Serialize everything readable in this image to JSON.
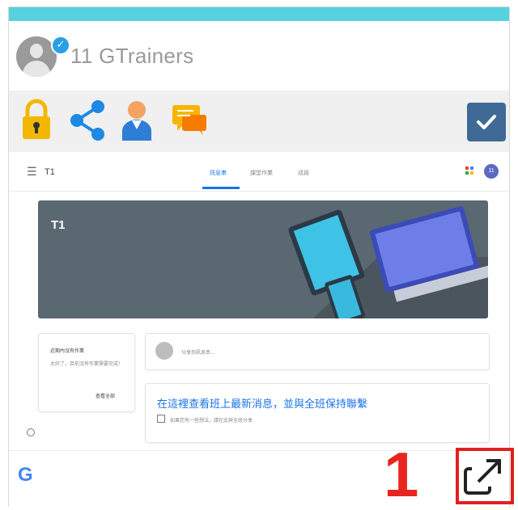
{
  "header": {
    "title": "11 GTrainers"
  },
  "toolbar": {
    "icons": [
      "lock-icon",
      "share-icon",
      "user-icon",
      "chat-icon"
    ],
    "check_icon": "check-icon"
  },
  "classroom": {
    "class_name": "T1",
    "tabs": [
      "訊息串",
      "課堂作業",
      "成員"
    ],
    "user_initial": "11",
    "banner_title": "T1",
    "upcoming_title": "近期內沒有作業",
    "upcoming_text": "太好了，目前沒有作業需要完成！",
    "upcoming_link": "查看全部",
    "post_placeholder": "分享到訊息串...",
    "main_message": "在這裡查看班上最新消息，並與全班保持聯繫",
    "main_sub": "如果您有一些想法，請在此與全班分享"
  },
  "footer": {
    "google_mark": "G",
    "step_number": "1",
    "external_icon": "open-in-new-icon"
  },
  "colors": {
    "topbar": "#55d2de",
    "check_bg": "#3f6a96",
    "accent_blue": "#1a73e8",
    "annotation_red": "#e02020"
  }
}
